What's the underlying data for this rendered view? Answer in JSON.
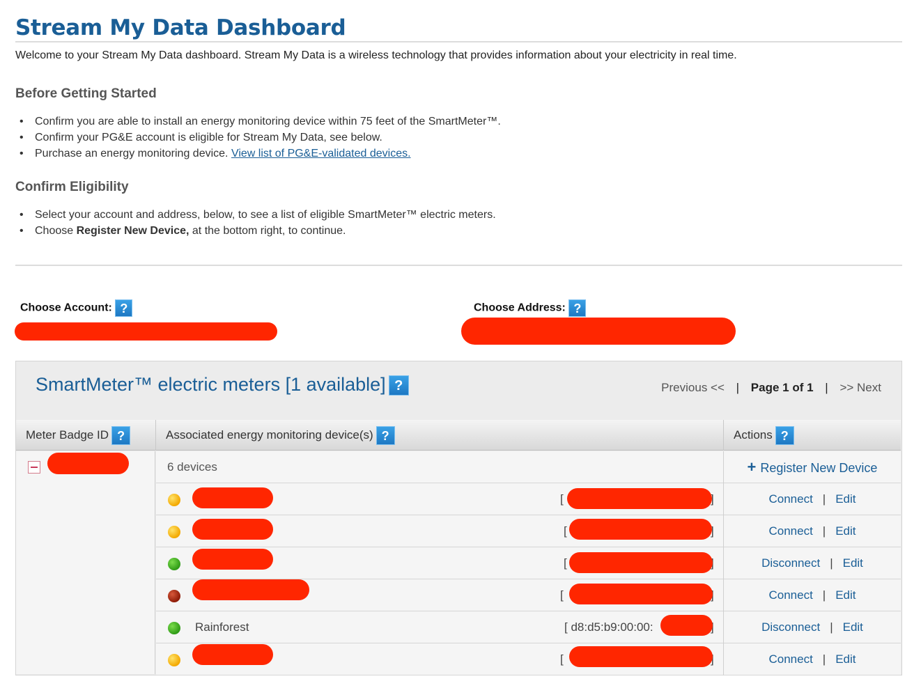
{
  "page": {
    "title": "Stream My Data Dashboard",
    "welcome": "Welcome to your Stream My Data dashboard. Stream My Data is a wireless technology that provides information about your electricity in real time."
  },
  "before_started": {
    "heading": "Before Getting Started",
    "items": [
      "Confirm you are able to install an energy monitoring device within 75 feet of the SmartMeter™.",
      "Confirm your PG&E account is eligible for Stream My Data, see below.",
      "Purchase an energy monitoring device. "
    ],
    "link_text": "View list of PG&E-validated devices."
  },
  "eligibility": {
    "heading": "Confirm Eligibility",
    "item1": "Select your account and address, below, to see a list of eligible SmartMeter™ electric meters.",
    "item2_pre": "Choose ",
    "item2_bold": "Register New Device,",
    "item2_post": " at the bottom right, to continue."
  },
  "choosers": {
    "account_label": "Choose Account:",
    "address_label": "Choose Address:",
    "help_glyph": "?"
  },
  "meters": {
    "title": "SmartMeter™ electric meters [1 available]",
    "pager": {
      "previous": "Previous <<",
      "page": "Page 1 of 1",
      "sep": "|",
      "next": ">> Next"
    },
    "columns": {
      "badge": "Meter Badge ID",
      "devices": "Associated energy monitoring device(s)",
      "actions": "Actions"
    },
    "device_count": "6 devices",
    "register_label": "Register New Device",
    "register_icon": "+",
    "edit_label": "Edit",
    "pipe": "|",
    "bracket_open": "[",
    "bracket_close": "]",
    "devices": [
      {
        "status": "yellow",
        "name": "",
        "mac": "",
        "action": "Connect"
      },
      {
        "status": "yellow",
        "name": "",
        "mac": "",
        "action": "Connect"
      },
      {
        "status": "green",
        "name": "",
        "mac": "",
        "action": "Disconnect"
      },
      {
        "status": "red",
        "name": "",
        "mac": "",
        "action": "Connect"
      },
      {
        "status": "green",
        "name": "Rainforest",
        "mac": "[ d8:d5:b9:00:00:",
        "action": "Disconnect"
      },
      {
        "status": "yellow",
        "name": "",
        "mac": "",
        "action": "Connect"
      }
    ]
  },
  "colors": {
    "brand_blue": "#1a5e96",
    "redaction": "#ff2600",
    "status_yellow": "#f3a800",
    "status_green": "#2f9b16",
    "status_red": "#8e1b07"
  }
}
